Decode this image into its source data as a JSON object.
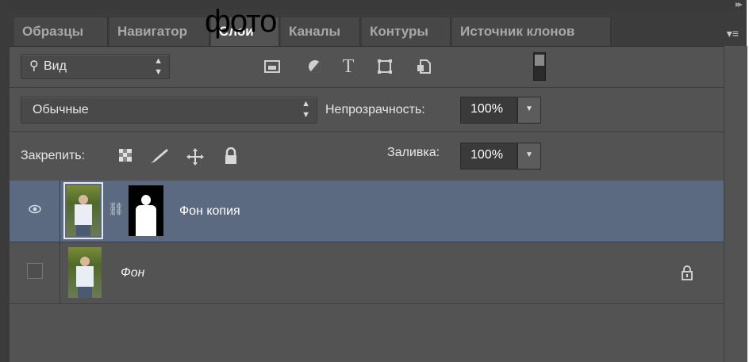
{
  "overlay_text": "фото",
  "tabs": [
    {
      "label": "Образцы",
      "active": false
    },
    {
      "label": "Навигатор",
      "active": false
    },
    {
      "label": "Слои",
      "active": true
    },
    {
      "label": "Каналы",
      "active": false
    },
    {
      "label": "Контуры",
      "active": false
    },
    {
      "label": "Источник клонов",
      "active": false
    }
  ],
  "filter": {
    "kind_label": "Вид",
    "icons": [
      "image-filter-icon",
      "adjustment-filter-icon",
      "type-filter-icon",
      "shape-filter-icon",
      "smart-object-filter-icon"
    ]
  },
  "blend": {
    "mode": "Обычные",
    "opacity_label": "Непрозрачность:",
    "opacity_value": "100%"
  },
  "lock": {
    "label": "Закрепить:",
    "fill_label": "Заливка:",
    "fill_value": "100%"
  },
  "layers": [
    {
      "name": "Фон копия",
      "selected": true,
      "visible": true,
      "has_mask": true
    },
    {
      "name": "Фон",
      "selected": false,
      "visible": false,
      "locked": true
    }
  ],
  "colors": {
    "panel_bg": "#535353",
    "selected_row": "#5b6a80",
    "tabbar_bg": "#3c3c3c"
  }
}
